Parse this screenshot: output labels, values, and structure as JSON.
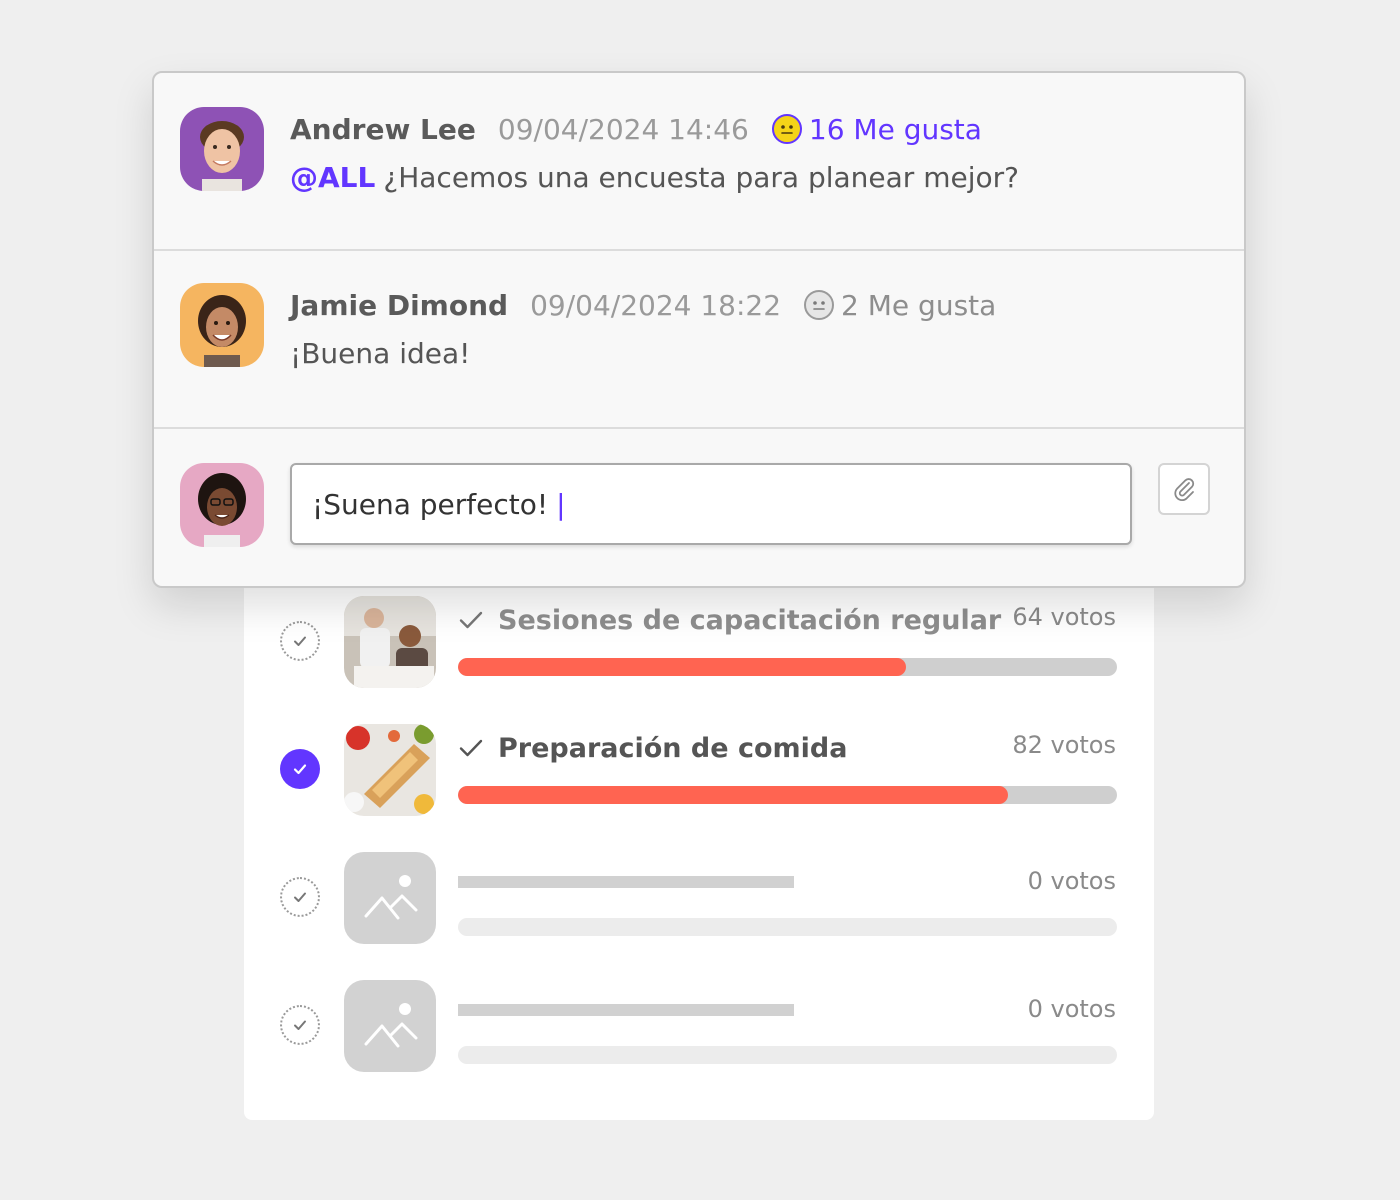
{
  "chat": {
    "messages": [
      {
        "author": "Andrew Lee",
        "timestamp": "09/04/2024 14:46",
        "likes": "16 Me gusta",
        "liked": true,
        "mention": "@ALL",
        "text": "¿Hacemos una encuesta para planear mejor?",
        "avatar_icon": "avatar-man-icon"
      },
      {
        "author": "Jamie Dimond",
        "timestamp": "09/04/2024 18:22",
        "likes": "2 Me gusta",
        "liked": false,
        "text": "¡Buena idea!",
        "avatar_icon": "avatar-woman-icon"
      }
    ],
    "composer": {
      "value": "¡Suena perfecto!",
      "attach_icon": "paperclip-icon"
    }
  },
  "poll": {
    "options": [
      {
        "label": "Sesiones de capacitación regular",
        "votes": "64 votos",
        "fraction": 0.68,
        "selected": false,
        "thumb_icon": "training-photo-icon"
      },
      {
        "label": "Preparación de comida",
        "votes": "82 votos",
        "fraction": 0.834,
        "selected": true,
        "thumb_icon": "food-photo-icon"
      },
      {
        "label": "",
        "votes": "0 votos",
        "fraction": 0,
        "selected": false,
        "thumb_icon": "image-placeholder-icon"
      },
      {
        "label": "",
        "votes": "0 votos",
        "fraction": 0,
        "selected": false,
        "thumb_icon": "image-placeholder-icon"
      }
    ]
  },
  "colors": {
    "accent": "#6236ff",
    "bar": "#ff6451",
    "like_emoji": "#f5d418"
  }
}
